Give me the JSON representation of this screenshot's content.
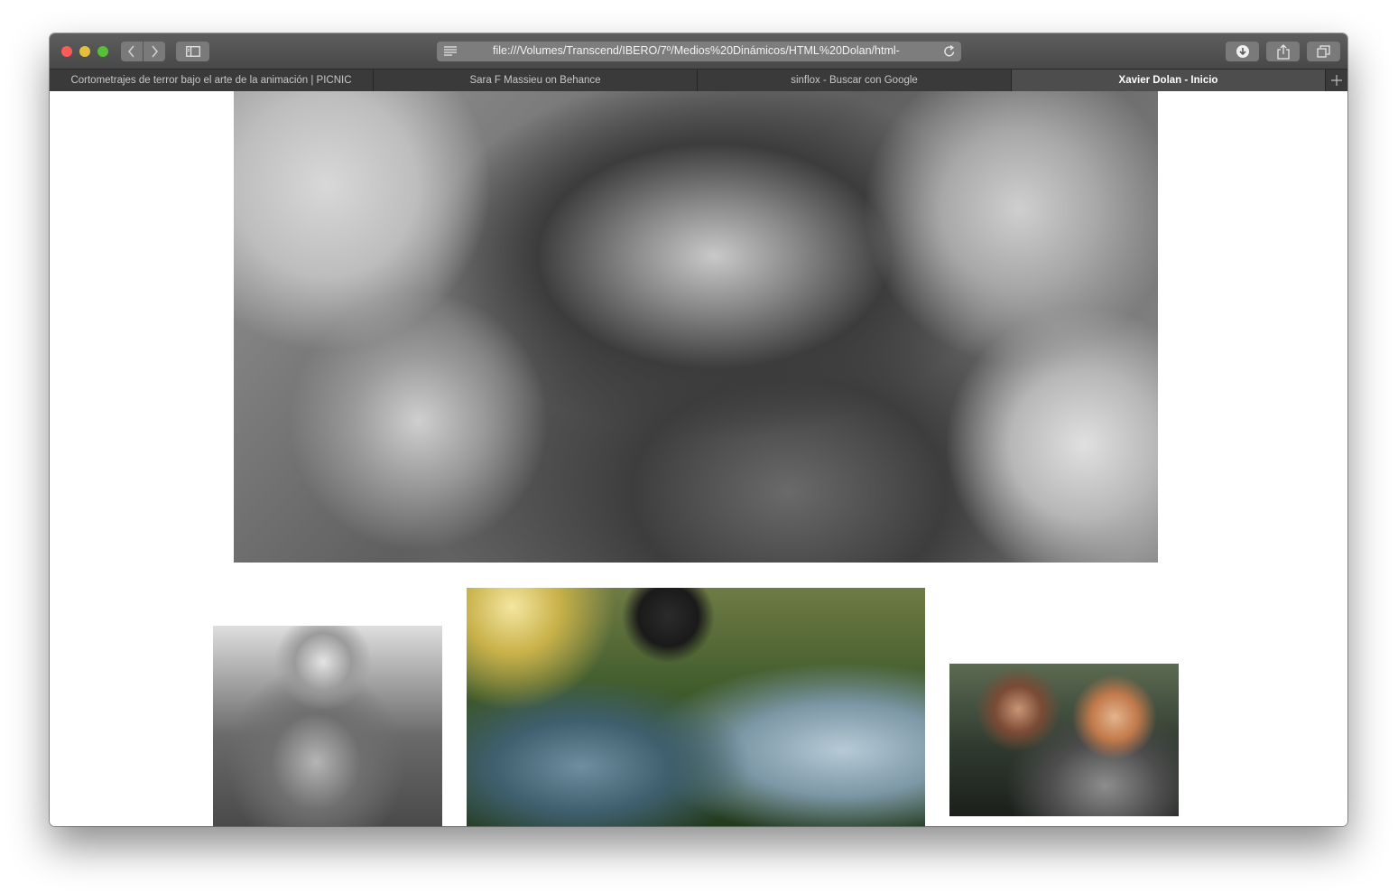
{
  "browser": {
    "address_bar": {
      "url": "file:///Volumes/Transcend/IBERO/7º/Medios%20Dinámicos/HTML%20Dolan/html-"
    },
    "tabs": [
      {
        "label": "Cortometrajes de terror bajo el arte de la animación | PICNIC",
        "active": false
      },
      {
        "label": "Sara F Massieu on Behance",
        "active": false
      },
      {
        "label": "sinflox - Buscar con Google",
        "active": false
      },
      {
        "label": "Xavier Dolan - Inicio",
        "active": true
      }
    ],
    "icons": [
      "back-icon",
      "forward-icon",
      "sidebar-icon",
      "reader-icon",
      "reload-icon",
      "download-icon",
      "share-icon",
      "tabs-overview-icon",
      "new-tab-icon"
    ]
  },
  "page": {
    "photos": [
      {
        "role": "hero",
        "description_tone": "black-and-white portrait"
      },
      {
        "role": "thumbnail-left",
        "description_tone": "black-and-white"
      },
      {
        "role": "thumbnail-center",
        "description_tone": "color, forest"
      },
      {
        "role": "thumbnail-right",
        "description_tone": "color"
      }
    ]
  },
  "colors": {
    "titlebar": "#545454",
    "tabbar": "#3a3a3a",
    "active_tab": "#4d4d4d",
    "close": "#fc5b57",
    "minimize": "#e5bf3c",
    "maximize": "#57c038",
    "page_background": "#ffffff"
  }
}
